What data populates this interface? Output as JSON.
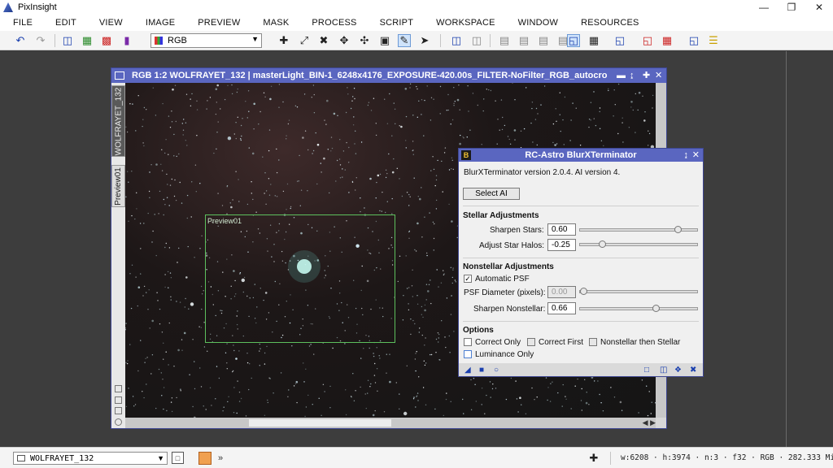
{
  "app": {
    "title": "PixInsight"
  },
  "menu": [
    "FILE",
    "EDIT",
    "VIEW",
    "IMAGE",
    "PREVIEW",
    "MASK",
    "PROCESS",
    "SCRIPT",
    "WORKSPACE",
    "WINDOW",
    "RESOURCES"
  ],
  "toolbar": {
    "channel_select": "RGB"
  },
  "image_window": {
    "title": "RGB 1:2 WOLFRAYET_132 | masterLight_BIN-1_6248x4176_EXPOSURE-420.00s_FILTER-NoFilter_RGB_autocro...",
    "tabs": [
      "WOLFRAYET_132",
      "Preview01"
    ],
    "preview_label": "Preview01"
  },
  "dialog": {
    "title": "RC-Astro BlurXTerminator",
    "badge": "B",
    "version": "BlurXTerminator version 2.0.4. AI version 4.",
    "select_ai": "Select AI",
    "stellar_heading": "Stellar Adjustments",
    "sharpen_stars_label": "Sharpen Stars:",
    "sharpen_stars_value": "0.60",
    "sharpen_stars_level": 0.6,
    "adjust_halos_label": "Adjust Star Halos:",
    "adjust_halos_value": "-0.25",
    "adjust_halos_level": -0.25,
    "nonstellar_heading": "Nonstellar Adjustments",
    "automatic_psf_label": "Automatic PSF",
    "automatic_psf_checked": true,
    "psf_diameter_label": "PSF Diameter (pixels):",
    "psf_diameter_value": "0.00",
    "sharpen_nonstellar_label": "Sharpen Nonstellar:",
    "sharpen_nonstellar_value": "0.66",
    "sharpen_nonstellar_level": 0.66,
    "options_heading": "Options",
    "correct_only": "Correct Only",
    "correct_first": "Correct First",
    "nonstellar_then_stellar": "Nonstellar then Stellar",
    "luminance_only": "Luminance Only",
    "check_mark": "✓"
  },
  "statusbar": {
    "view": "WOLFRAYET_132",
    "info": "w:6208 · h:3974 · n:3 · f32 · RGB · 282.333 MiB ·"
  }
}
